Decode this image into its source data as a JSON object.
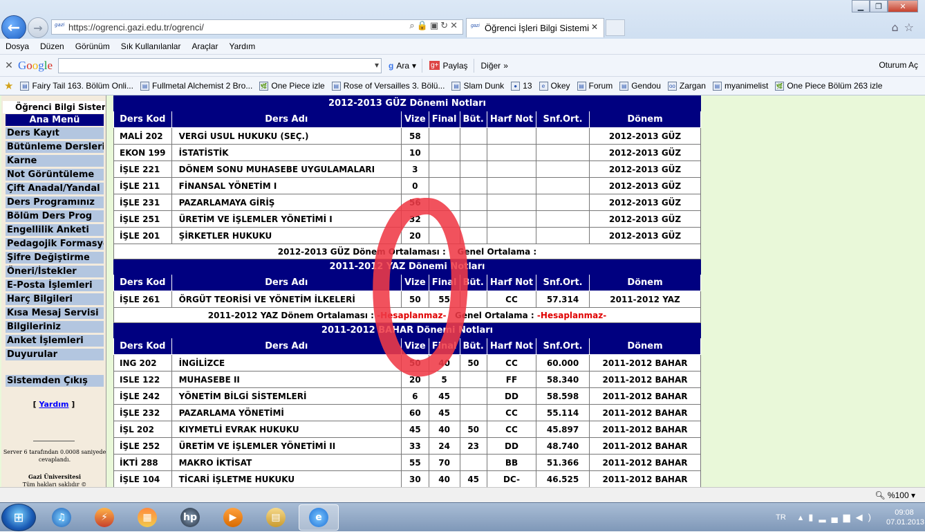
{
  "browser": {
    "url": "https://ogrenci.gazi.edu.tr/ogrenci/",
    "favicon_text": "gazi",
    "tab_title": "Öğrenci İşleri Bilgi Sistemi",
    "window_controls": [
      "minimize-icon",
      "restore-icon",
      "close-icon"
    ],
    "menu": [
      "Dosya",
      "Düzen",
      "Görünüm",
      "Sık Kullanılanlar",
      "Araçlar",
      "Yardım"
    ],
    "google_toolbar": {
      "logo": "Google",
      "search_value": "",
      "search_label": "Ara",
      "share_label": "Paylaş",
      "more_label": "Diğer",
      "signin_label": "Oturum Aç"
    },
    "favorites": [
      {
        "label": "Fairy Tail 163. Bölüm Onli...",
        "icon": "page-icon"
      },
      {
        "label": "Fullmetal Alchemist 2 Bro...",
        "icon": "page-icon"
      },
      {
        "label": "One Piece izle",
        "icon": "leaf-icon"
      },
      {
        "label": "Rose of Versailles 3. Bölü...",
        "icon": "page-icon"
      },
      {
        "label": "Slam Dunk",
        "icon": "page-icon"
      },
      {
        "label": "13",
        "icon": "ball-icon"
      },
      {
        "label": "Okey",
        "icon": "ie-icon"
      },
      {
        "label": "Forum",
        "icon": "page-icon"
      },
      {
        "label": "Gendou",
        "icon": "page-icon"
      },
      {
        "label": "Zargan",
        "icon": "glasses-icon"
      },
      {
        "label": "myanimelist",
        "icon": "page-icon"
      },
      {
        "label": "One Piece Bölüm 263 izle",
        "icon": "leaf-icon"
      }
    ]
  },
  "sidebar": {
    "title": "Öğrenci Bilgi Sistemi",
    "menu_header": "Ana Menü",
    "items": [
      "Ders Kayıt",
      "Bütünleme Dersleri",
      "Karne",
      "Not Görüntüleme",
      "Çift Anadal/Yandal",
      "Ders Programınız",
      "Bölüm Ders Prog",
      "Engellilik Anketi",
      "Pedagojik Formasyon",
      "Şifre Değiştirme",
      "Öneri/İstekler",
      "E-Posta İşlemleri",
      "Harç Bilgileri",
      "Kısa Mesaj Servisi",
      "Bilgileriniz",
      "Anket İşlemleri",
      "Duyurular"
    ],
    "logout": "Sistemden Çıkış",
    "help": "Yardım",
    "server_info": "Server 6 tarafından 0.0008 saniyede cevaplandı.",
    "university": "Gazi Üniversitesi",
    "rights": "Tüm hakları saklıdır ©"
  },
  "columns": [
    "Ders Kod",
    "Ders Adı",
    "Vize",
    "Final",
    "Büt.",
    "Harf Not",
    "Snf.Ort.",
    "Dönem"
  ],
  "semesters": [
    {
      "title": "2012-2013 GÜZ Dönemi Notları",
      "rows": [
        [
          "MALİ 202",
          "VERGİ USUL HUKUKU (SEÇ.)",
          "58",
          "",
          "",
          "",
          "",
          "2012-2013 GÜZ"
        ],
        [
          "EKON 199",
          "İSTATİSTİK",
          "10",
          "",
          "",
          "",
          "",
          "2012-2013 GÜZ"
        ],
        [
          "İŞLE 221",
          "DÖNEM SONU MUHASEBE UYGULAMALARI",
          "3",
          "",
          "",
          "",
          "",
          "2012-2013 GÜZ"
        ],
        [
          "İŞLE 211",
          "FİNANSAL YÖNETİM I",
          "0",
          "",
          "",
          "",
          "",
          "2012-2013 GÜZ"
        ],
        [
          "İŞLE 231",
          "PAZARLAMAYA GİRİŞ",
          "56",
          "",
          "",
          "",
          "",
          "2012-2013 GÜZ"
        ],
        [
          "İŞLE 251",
          "ÜRETİM VE İŞLEMLER YÖNETİMİ I",
          "32",
          "",
          "",
          "",
          "",
          "2012-2013 GÜZ"
        ],
        [
          "İŞLE 201",
          "ŞİRKETLER HUKUKU",
          "20",
          "",
          "",
          "",
          "",
          "2012-2013 GÜZ"
        ]
      ],
      "avg_label": "2012-2013 GÜZ Dönem Ortalaması :",
      "avg_value": "",
      "general_label": "Genel Ortalama :",
      "general_value": ""
    },
    {
      "title": "2011-2012 YAZ Dönemi Notları",
      "rows": [
        [
          "İŞLE 261",
          "ÖRGÜT TEORİSİ VE YÖNETİM İLKELERİ",
          "50",
          "55",
          "",
          "CC",
          "57.314",
          "2011-2012 YAZ"
        ]
      ],
      "avg_label": "2011-2012 YAZ Dönem Ortalaması :",
      "avg_value": "-Hesaplanmaz-",
      "general_label": "Genel Ortalama :",
      "general_value": "-Hesaplanmaz-"
    },
    {
      "title": "2011-2012 BAHAR Dönemi Notları",
      "rows": [
        [
          "ING 202",
          "İNGİLİZCE",
          "50",
          "40",
          "50",
          "CC",
          "60.000",
          "2011-2012 BAHAR"
        ],
        [
          "ISLE 122",
          "MUHASEBE II",
          "20",
          "5",
          "",
          "FF",
          "58.340",
          "2011-2012 BAHAR"
        ],
        [
          "İŞLE 242",
          "YÖNETİM BİLGİ SİSTEMLERİ",
          "6",
          "45",
          "",
          "DD",
          "58.598",
          "2011-2012 BAHAR"
        ],
        [
          "İŞLE 232",
          "PAZARLAMA YÖNETİMİ",
          "60",
          "45",
          "",
          "CC",
          "55.114",
          "2011-2012 BAHAR"
        ],
        [
          "İŞL 202",
          "KIYMETLİ EVRAK HUKUKU",
          "45",
          "40",
          "50",
          "CC",
          "45.897",
          "2011-2012 BAHAR"
        ],
        [
          "İŞLE 252",
          "ÜRETİM VE İŞLEMLER YÖNETİMİ II",
          "33",
          "24",
          "23",
          "DD",
          "48.740",
          "2011-2012 BAHAR"
        ],
        [
          "İKTİ 288",
          "MAKRO İKTİSAT",
          "55",
          "70",
          "",
          "BB",
          "51.366",
          "2011-2012 BAHAR"
        ],
        [
          "İŞLE 104",
          "TİCARİ İŞLETME HUKUKU",
          "30",
          "40",
          "45",
          "DC-",
          "46.525",
          "2011-2012 BAHAR"
        ]
      ]
    }
  ],
  "annotation_color": "#ef3a47",
  "statusbar": {
    "zoom": "%100"
  },
  "taskbar": {
    "apps": [
      "itunes-icon",
      "winamp-icon",
      "paint-icon",
      "hp-icon",
      "media-icon",
      "explorer-icon",
      "ie-icon"
    ],
    "lang": "TR",
    "time": "09:08",
    "date": "07.01.2013"
  }
}
